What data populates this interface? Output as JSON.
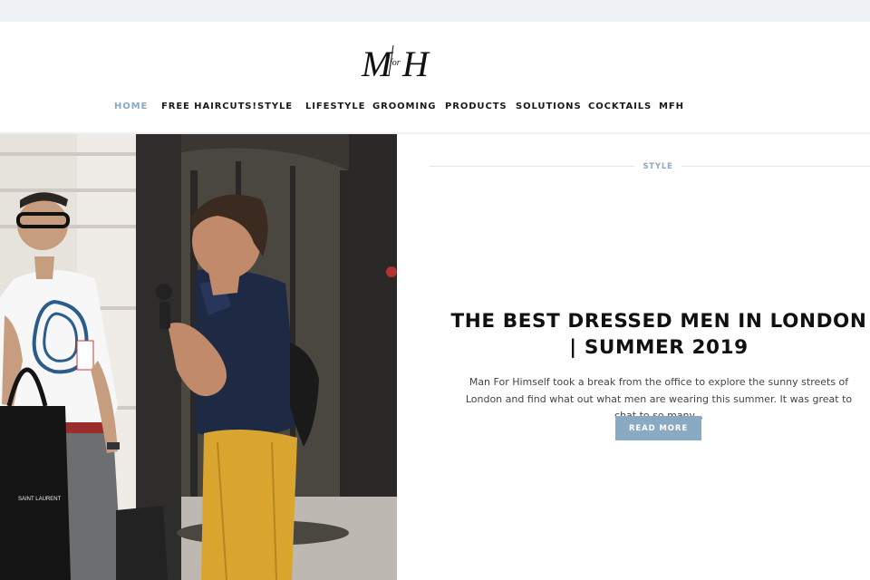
{
  "header": {
    "logo_text": "M for H"
  },
  "nav": {
    "items": [
      {
        "label": "HOME"
      },
      {
        "label": "FREE HAIRCUTS!"
      },
      {
        "label": "STYLE"
      },
      {
        "label": "LIFESTYLE"
      },
      {
        "label": "GROOMING"
      },
      {
        "label": "PRODUCTS"
      },
      {
        "label": "SOLUTIONS"
      },
      {
        "label": "COCKTAILS"
      },
      {
        "label": "MFH"
      }
    ],
    "active": "HOME"
  },
  "featured": {
    "category": "STYLE",
    "title": "THE BEST DRESSED MEN IN LONDON | SUMMER 2019",
    "excerpt": "Man For Himself took a break from the office to explore the sunny streets of London and find what out what men are wearing this summer. It was great to chat to so many...",
    "read_more": "READ MORE",
    "image_bag_text": "SAINT LAURENT"
  },
  "colors": {
    "accent": "#8aaac4",
    "topbar": "#eef2f5",
    "text": "#111111"
  }
}
